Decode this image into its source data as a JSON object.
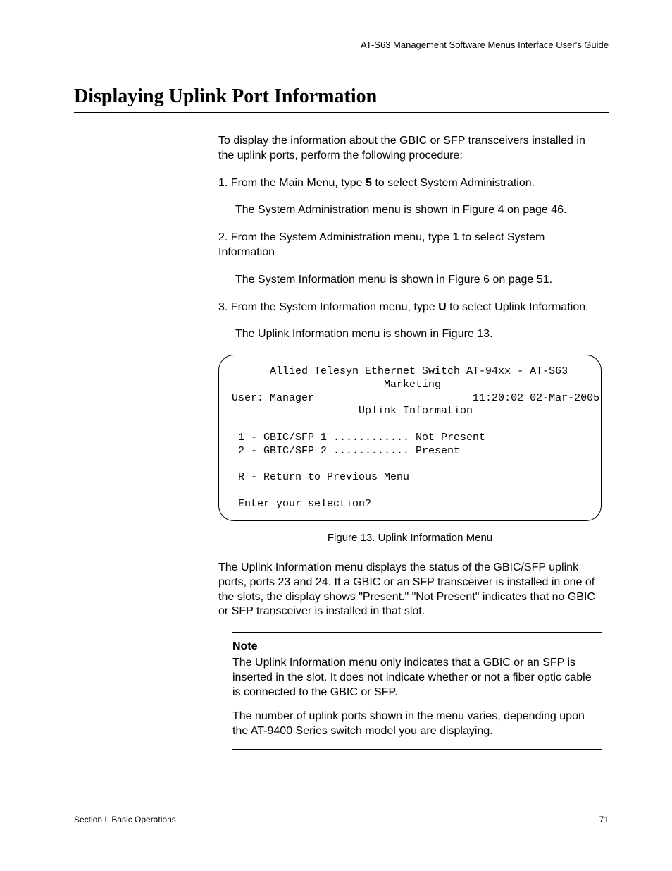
{
  "header": {
    "guide_title": "AT-S63 Management Software Menus Interface User's Guide"
  },
  "title": "Displaying Uplink Port Information",
  "intro": "To display the information about the GBIC or SFP transceivers installed in the uplink ports, perform the following procedure:",
  "steps": {
    "s1_pre": "1.  From the Main Menu, type ",
    "s1_bold": "5",
    "s1_post": " to select System Administration.",
    "s1_sub": "The System Administration menu is shown in Figure 4 on page 46.",
    "s2_pre": "2.  From the System Administration menu, type ",
    "s2_bold": "1",
    "s2_post": " to select System Information",
    "s2_sub": "The System Information menu is shown in Figure 6 on page 51.",
    "s3_pre": "3.  From the System Information menu, type ",
    "s3_bold": "U",
    "s3_post": " to select Uplink Information.",
    "s3_sub": "The Uplink Information menu is shown in Figure 13."
  },
  "terminal": {
    "line1": "      Allied Telesyn Ethernet Switch AT-94xx - AT-S63",
    "line2": "                        Marketing",
    "line3": "User: Manager                         11:20:02 02-Mar-2005",
    "line4": "                    Uplink Information",
    "line5": "",
    "line6": " 1 - GBIC/SFP 1 ............ Not Present",
    "line7": " 2 - GBIC/SFP 2 ............ Present",
    "line8": "",
    "line9": " R - Return to Previous Menu",
    "line10": "",
    "line11": " Enter your selection?"
  },
  "figure_caption": "Figure 13. Uplink Information Menu",
  "after_fig": "The Uplink Information menu displays the status of the GBIC/SFP uplink ports, ports 23 and 24. If a GBIC or an SFP transceiver is installed in one of the slots, the display shows \"Present.\" \"Not Present\" indicates that no GBIC or SFP transceiver is installed in that slot.",
  "note": {
    "label": "Note",
    "p1": "The Uplink Information menu only indicates that a GBIC or an SFP is inserted in the slot. It does not indicate whether or not a fiber optic cable is connected to the GBIC or SFP.",
    "p2": "The number of uplink ports shown in the menu varies, depending upon the AT-9400 Series switch model you are displaying."
  },
  "footer": {
    "section": "Section I: Basic Operations",
    "page": "71"
  }
}
